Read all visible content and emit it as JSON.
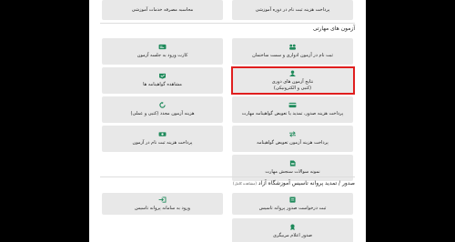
{
  "colors": {
    "background": "#000000",
    "page": "#ffffff",
    "card": "#e8e8e8",
    "icon": "#1f8a5b",
    "highlight": "#e01e1e"
  },
  "top_row": {
    "right": "پرداخت هزینه ثبت نام در دوره آموزشی",
    "left": "محاسبه مصرفه خدمات آموزشی"
  },
  "skills_section": {
    "title": "آزمون های مهارتی",
    "cards": [
      {
        "label": "ثبت نام در آزمون ادواری و سمت ساختمان",
        "icon": "users-icon"
      },
      {
        "label": "کارت ورود به جلسه آزمون",
        "icon": "id-card-icon"
      },
      {
        "label": "نتایج آزمون های دوری",
        "sub": "(کتبی و الکترونیکی)",
        "icon": "result-icon"
      },
      {
        "label": "مشاهده گواهینامه ها",
        "icon": "certificate-icon"
      },
      {
        "label": "پرداخت هزینه صدور، تمدید یا تعویض گواهینامه مهارت",
        "icon": "card-icon"
      },
      {
        "label": "هزینه آزمون مجدد (کتبی و عملی)",
        "icon": "refresh-icon"
      },
      {
        "label": "پرداخت هزینه آزمون تعویض گواهینامه",
        "icon": "exchange-icon"
      },
      {
        "label": "پرداخت هزینه ثبت نام در آزمون",
        "icon": "payment-icon"
      },
      {
        "label": "نمونه سوالات سنجش مهارت",
        "icon": "document-icon"
      }
    ]
  },
  "license_section": {
    "title": "صدور / تمدید پروانه تاسیس آموزشگاه آزاد",
    "note": "(مشاهده کامل)",
    "cards": [
      {
        "label": "ثبت درخواست صدور پروانه تاسیس",
        "icon": "form-icon"
      },
      {
        "label": "ورود به سامانه پروانه تاسیس",
        "icon": "login-icon"
      },
      {
        "label": "صدور اعلام مربیگری",
        "icon": "badge-icon"
      }
    ]
  }
}
